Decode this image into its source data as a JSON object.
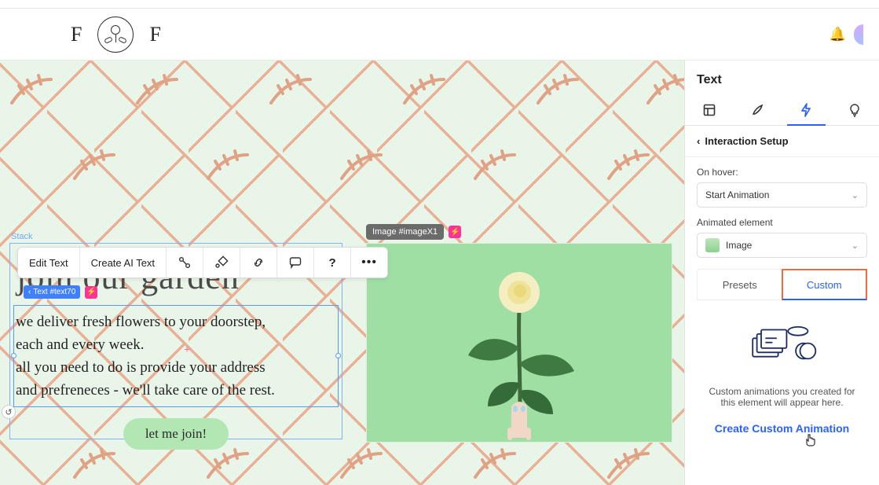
{
  "logo": {
    "left": "F",
    "right": "F"
  },
  "canvas": {
    "stack_label": "Stack",
    "heading": "join our garden",
    "text_line1": "we deliver fresh flowers to your doorstep,",
    "text_line2": "each and every week.",
    "text_line3": "all you need to do is provide your address",
    "text_line4": "and prefreneces - we'll take care of the rest.",
    "cta": "let me join!",
    "selected_text_tag": "Text #text70",
    "image_tag": "Image #imageX1"
  },
  "toolbar": {
    "edit_text": "Edit Text",
    "create_ai": "Create AI Text"
  },
  "panel": {
    "title": "Text",
    "back": "Interaction Setup",
    "on_hover_label": "On hover:",
    "on_hover_value": "Start Animation",
    "animated_element_label": "Animated element",
    "animated_element_value": "Image",
    "tab_presets": "Presets",
    "tab_custom": "Custom",
    "empty_line1": "Custom animations you created for",
    "empty_line2": "this element will appear here.",
    "create_custom": "Create Custom Animation"
  }
}
